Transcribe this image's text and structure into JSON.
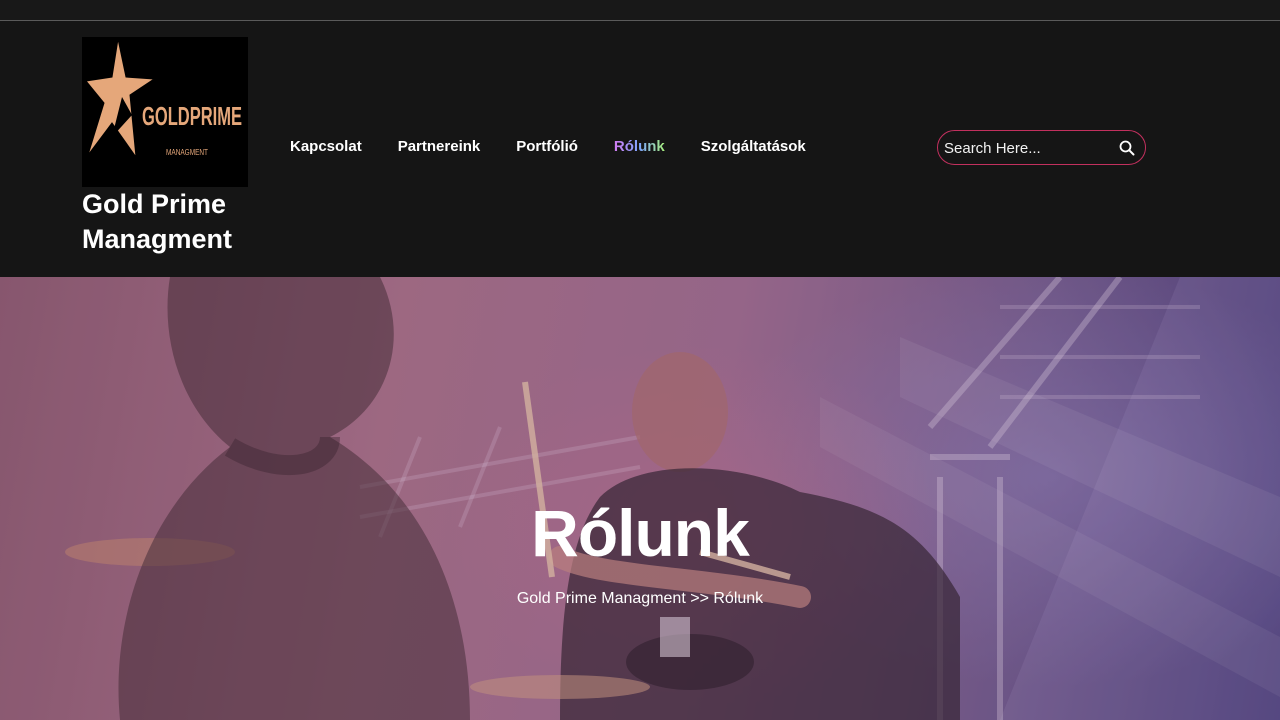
{
  "brand": {
    "logo_text": "GOLDPRIME",
    "logo_subtext": "MANAGMENT",
    "site_title_line1": "Gold Prime",
    "site_title_line2": "Managment",
    "logo_color": "#e5a77a"
  },
  "nav": {
    "items": [
      {
        "label": "Kapcsolat"
      },
      {
        "label": "Partnereink"
      },
      {
        "label": "Portfólió"
      },
      {
        "label": "Rólunk",
        "active": true
      },
      {
        "label": "Szolgáltatások"
      }
    ]
  },
  "search": {
    "placeholder": "Search Here...",
    "icon": "search-icon",
    "border_color": "#c2305e"
  },
  "hero": {
    "title": "Rólunk",
    "breadcrumb_home": "Gold Prime Managment",
    "breadcrumb_separator": ">>",
    "breadcrumb_current": "Rólunk"
  }
}
